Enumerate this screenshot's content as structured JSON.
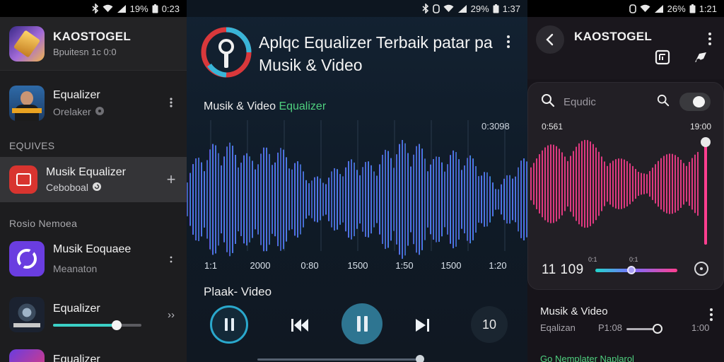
{
  "status_left": {
    "time": "0:23",
    "battery": "19%"
  },
  "status_center": {
    "time": "1:37",
    "battery": "29%"
  },
  "status_right": {
    "time": "1:21",
    "battery": "26%"
  },
  "left_panel": {
    "header_title": "KAOSTOGEL",
    "header_sub": "Bpuitesn 1c 0:0",
    "items": [
      {
        "title": "Equalizer",
        "sub": "Orelaker",
        "trail_icon": "kebab-icon"
      },
      {
        "title": "Musik Equalizer",
        "sub": "Ceboboal",
        "trail": "+",
        "selected": true
      },
      {
        "title": "Musik Eoquaee",
        "sub": "Meanaton",
        "trail_icon": "kebab-icon"
      },
      {
        "title": "Equalizer",
        "slider_level": 0.72,
        "trail": "››"
      },
      {
        "title": "Equalizer"
      }
    ],
    "section_1": "EQUIVES",
    "section_2": "Rosio Nemoea"
  },
  "center_panel": {
    "title": "Aplqc Equalizer Terbaik patar pa Musik & Video",
    "label_prefix": "Musik & Video",
    "label_accent": "Equalizer",
    "corner_value": "0:3098",
    "ticks": [
      "1:1",
      "2000",
      "0:80",
      "1500",
      "1:50",
      "1500",
      "1:20"
    ],
    "play_label": "Plaak- Video",
    "ten_label": "10",
    "colors": {
      "wave_start": "#8a3cf0",
      "wave_end": "#22c6e8",
      "accent": "#4fd07f"
    }
  },
  "right_panel": {
    "title": "KAOSTOGEL",
    "search_placeholder": "Equdic",
    "time_start": "0:561",
    "time_end": "19:00",
    "small_label_1": "0:1",
    "small_label_2": "0:1",
    "current_time": "11 109",
    "volume_level": 0.97,
    "progress_level": 0.44,
    "list_title": "Musik & Video",
    "sub_label": "Eqalizan",
    "sub_value": "P1:08",
    "sub_right": "1:00",
    "footer": "Go Nemplater  Naplarol",
    "colors": {
      "wave": "#ff3e8f"
    }
  }
}
